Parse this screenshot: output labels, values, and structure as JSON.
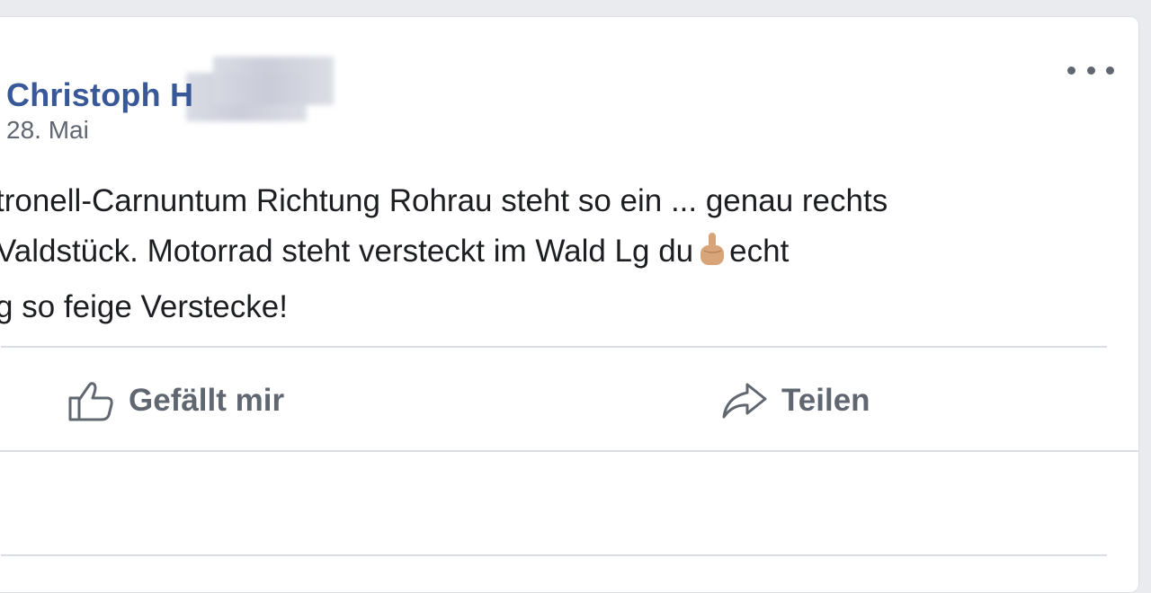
{
  "post": {
    "author": "Christoph H",
    "date": "28. Mai",
    "text_lines": [
      "tronell-Carnuntum Richtung Rohrau steht so ein ... genau rechts",
      "aldstück. Motorrad steht versteckt im Wald Lg du",
      "echt",
      "so feige Verstecke!"
    ],
    "line1_prefix": "V",
    "line3_prefix": "g",
    "emoji": "middle-finger-emoji"
  },
  "actions": {
    "like_label": "Gefällt mir",
    "share_label": "Teilen"
  },
  "icons": {
    "menu": "more-options-icon",
    "like": "thumbs-up-icon",
    "share": "share-arrow-icon"
  },
  "colors": {
    "author_blue": "#385898",
    "text": "#1c1e21",
    "secondary": "#606770",
    "divider": "#dadde1",
    "page_bg": "#e9ebee"
  }
}
